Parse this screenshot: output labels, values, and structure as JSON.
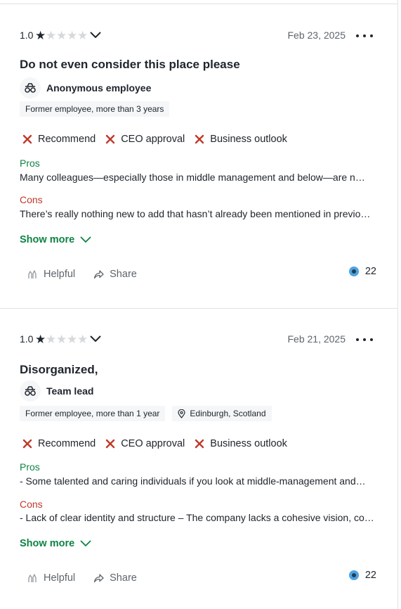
{
  "reviews": [
    {
      "rating": "1.0",
      "rating_value": 1,
      "date": "Feb 23, 2025",
      "title": "Do not even consider this place please",
      "author": "Anonymous employee",
      "tags": [
        "Former employee, more than 3 years"
      ],
      "location": "",
      "recommend": "Recommend",
      "ceo_approval": "CEO approval",
      "business_outlook": "Business outlook",
      "pros_label": "Pros",
      "pros": "Many colleagues—especially those in middle management and below—are not…",
      "cons_label": "Cons",
      "cons": "There’s really nothing new to add that hasn’t already been mentioned in previous…",
      "show_more": "Show more",
      "helpful": "Helpful",
      "share": "Share",
      "reaction_count": "22"
    },
    {
      "rating": "1.0",
      "rating_value": 1,
      "date": "Feb 21, 2025",
      "title": "Disorganized,",
      "author": "Team lead",
      "tags": [
        "Former employee, more than 1 year"
      ],
      "location": "Edinburgh, Scotland",
      "recommend": "Recommend",
      "ceo_approval": "CEO approval",
      "business_outlook": "Business outlook",
      "pros_label": "Pros",
      "pros": "- Some talented and caring individuals if you look at middle-management and…",
      "cons_label": "Cons",
      "cons": "- Lack of clear identity and structure – The company lacks a cohesive vision, cor…",
      "show_more": "Show more",
      "helpful": "Helpful",
      "share": "Share",
      "reaction_count": "22"
    }
  ],
  "colors": {
    "pros": "#0e8345",
    "cons": "#c0392b",
    "negative_mark": "#c0392b",
    "link": "#0e8345",
    "text": "#20262e",
    "muted": "#5d646b"
  },
  "icons": {
    "star": "star-icon",
    "chevron": "chevron-down-icon",
    "more": "more-options-icon",
    "avatar": "employee-avatar-icon",
    "location": "location-pin-icon",
    "negative": "x-mark-icon",
    "helpful": "helpful-hands-icon",
    "share": "share-icon",
    "reaction": "reaction-icon"
  }
}
